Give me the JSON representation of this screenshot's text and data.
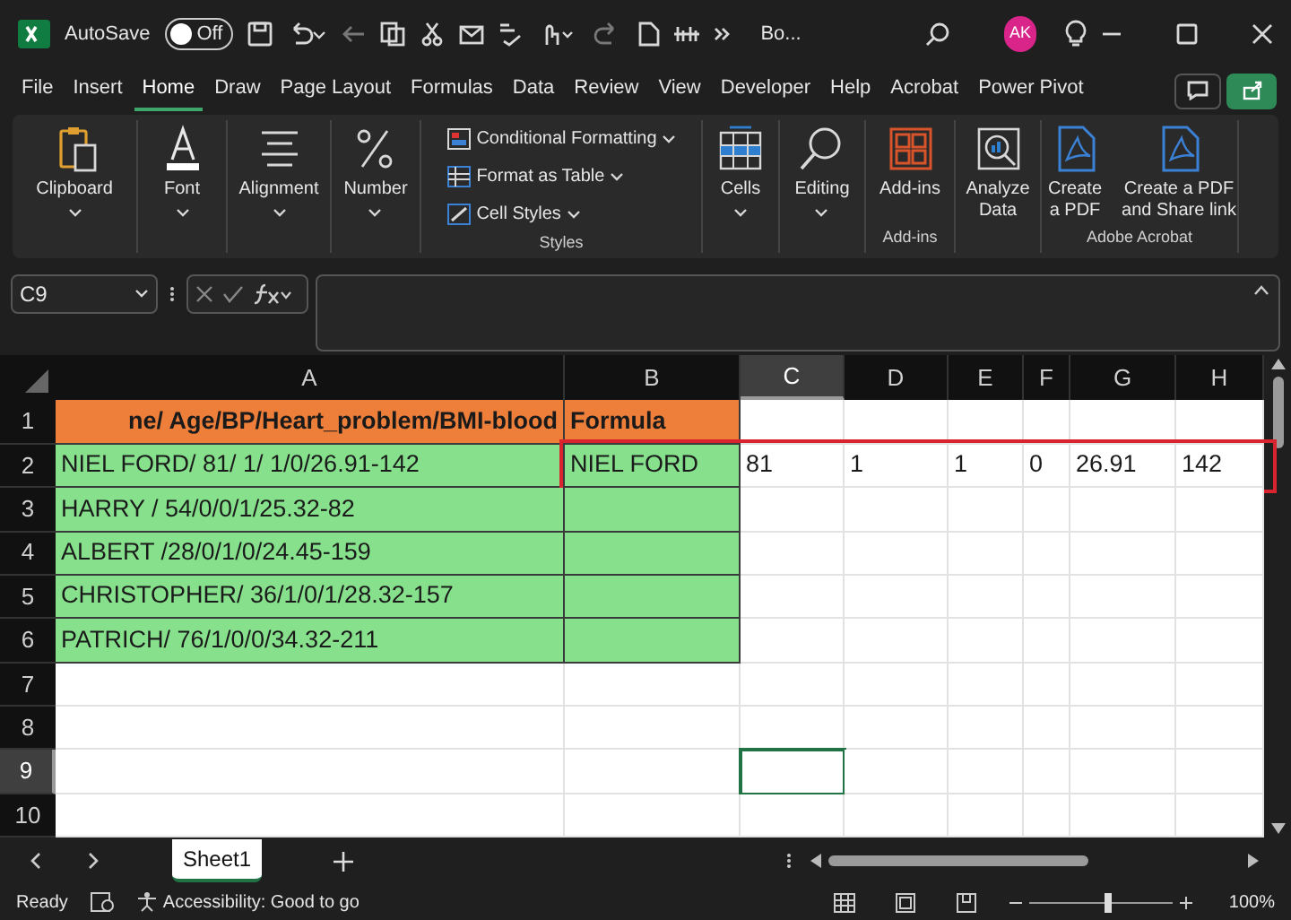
{
  "title_bar": {
    "autosave_label": "AutoSave",
    "autosave": {
      "label": "Off",
      "on": false
    },
    "file_name": "Bo...",
    "avatar": "AK"
  },
  "menu_tabs": [
    {
      "label": "File",
      "selected": false
    },
    {
      "label": "Insert",
      "selected": false
    },
    {
      "label": "Home",
      "selected": true
    },
    {
      "label": "Draw",
      "selected": false
    },
    {
      "label": "Page Layout",
      "selected": false
    },
    {
      "label": "Formulas",
      "selected": false
    },
    {
      "label": "Data",
      "selected": false
    },
    {
      "label": "Review",
      "selected": false
    },
    {
      "label": "View",
      "selected": false
    },
    {
      "label": "Developer",
      "selected": false
    },
    {
      "label": "Help",
      "selected": false
    },
    {
      "label": "Acrobat",
      "selected": false
    },
    {
      "label": "Power Pivot",
      "selected": false
    }
  ],
  "ribbon": {
    "groups": [
      {
        "items": [
          {
            "label": "Clipboard",
            "kind": "large",
            "dropdown": true
          }
        ]
      },
      {
        "items": [
          {
            "label": "Font",
            "kind": "large",
            "dropdown": true
          }
        ]
      },
      {
        "items": [
          {
            "label": "Alignment",
            "kind": "large",
            "dropdown": true
          }
        ]
      },
      {
        "items": [
          {
            "label": "Number",
            "kind": "large",
            "dropdown": true
          }
        ]
      },
      {
        "label": "Styles",
        "items": [
          {
            "label": "Conditional Formatting",
            "kind": "small",
            "dropdown": true
          },
          {
            "label": "Format as Table",
            "kind": "small",
            "dropdown": true
          },
          {
            "label": "Cell Styles",
            "kind": "small",
            "dropdown": true
          }
        ]
      },
      {
        "items": [
          {
            "label": "Cells",
            "kind": "large",
            "dropdown": true
          }
        ]
      },
      {
        "items": [
          {
            "label": "Editing",
            "kind": "large",
            "dropdown": true
          }
        ]
      },
      {
        "label": "Add-ins",
        "items": [
          {
            "label": "Add-ins",
            "kind": "large",
            "dropdown": false
          }
        ]
      },
      {
        "items": [
          {
            "label": "Analyze Data",
            "kind": "large",
            "dropdown": false
          }
        ]
      },
      {
        "label": "Adobe Acrobat",
        "items": [
          {
            "label": "Create a PDF",
            "kind": "large",
            "dropdown": false
          },
          {
            "label": "Create a PDF and Share link",
            "kind": "large",
            "dropdown": false
          }
        ]
      }
    ]
  },
  "formula_bar": {
    "name_box": "C9"
  },
  "grid": {
    "columns": [
      {
        "label": "A",
        "selected": false
      },
      {
        "label": "B",
        "selected": false
      },
      {
        "label": "C",
        "selected": true
      },
      {
        "label": "D",
        "selected": false
      },
      {
        "label": "E",
        "selected": false
      },
      {
        "label": "F",
        "selected": false
      },
      {
        "label": "G",
        "selected": false
      },
      {
        "label": "H",
        "selected": false
      }
    ],
    "rows": [
      {
        "label": "1",
        "selected": false,
        "outlined": false,
        "cells": [
          {
            "kind": "header",
            "text": "ne/ Age/BP/Heart_problem/BMI-blood"
          },
          {
            "kind": "header",
            "text": "Formula"
          }
        ]
      },
      {
        "label": "2",
        "selected": false,
        "outlined": true,
        "cells": [
          {
            "kind": "data",
            "text": "NIEL FORD/ 81/ 1/ 1/0/26.91-142"
          },
          {
            "kind": "data",
            "text": "NIEL FORD"
          },
          {
            "kind": "plain",
            "text": "81"
          },
          {
            "kind": "plain",
            "text": "1"
          },
          {
            "kind": "plain",
            "text": "1"
          },
          {
            "kind": "plain",
            "text": "0"
          },
          {
            "kind": "plain",
            "text": "26.91"
          },
          {
            "kind": "plain",
            "text": "142"
          }
        ]
      },
      {
        "label": "3",
        "selected": false,
        "outlined": false,
        "cells": [
          {
            "kind": "data",
            "text": "HARRY / 54/0/0/1/25.32-82"
          },
          {
            "kind": "data"
          }
        ]
      },
      {
        "label": "4",
        "selected": false,
        "outlined": false,
        "cells": [
          {
            "kind": "data",
            "text": "ALBERT /28/0/1/0/24.45-159"
          },
          {
            "kind": "data"
          }
        ]
      },
      {
        "label": "5",
        "selected": false,
        "outlined": false,
        "cells": [
          {
            "kind": "data",
            "text": "CHRISTOPHER/ 36/1/0/1/28.32-157"
          },
          {
            "kind": "data"
          }
        ]
      },
      {
        "label": "6",
        "selected": false,
        "outlined": false,
        "cells": [
          {
            "kind": "data",
            "text": "PATRICH/ 76/1/0/0/34.32-211"
          },
          {
            "kind": "data"
          }
        ]
      },
      {
        "label": "7",
        "selected": false,
        "outlined": false,
        "cells": []
      },
      {
        "label": "8",
        "selected": false,
        "outlined": false,
        "cells": []
      },
      {
        "label": "9",
        "selected": true,
        "outlined": false,
        "cells": []
      },
      {
        "label": "10",
        "selected": false,
        "outlined": false,
        "cells": []
      }
    ]
  },
  "sheet_tabs": [
    {
      "label": "Sheet1",
      "selected": true
    }
  ],
  "status_bar": {
    "status": "Ready",
    "accessibility": "Accessibility: Good to go",
    "zoom": {
      "label": "100%",
      "level": 0.55
    }
  }
}
